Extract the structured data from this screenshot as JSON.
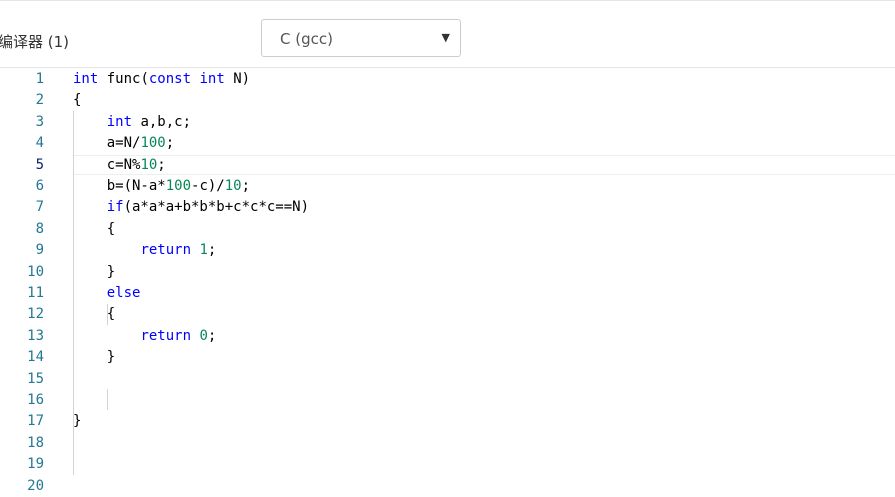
{
  "toolbar": {
    "compiler_label": "编译器 (1)",
    "language_selected": "C (gcc)",
    "dropdown_icon": "triangle-down-icon"
  },
  "editor": {
    "active_line": 5,
    "line_numbers": [
      "1",
      "2",
      "3",
      "4",
      "5",
      "6",
      "7",
      "8",
      "9",
      "10",
      "11",
      "12",
      "13",
      "14",
      "15",
      "16",
      "17",
      "18",
      "19",
      "20"
    ],
    "code_lines": [
      [
        {
          "t": "int",
          "c": "kw"
        },
        {
          "t": " func("
        },
        {
          "t": "const",
          "c": "kw"
        },
        {
          "t": " "
        },
        {
          "t": "int",
          "c": "kw"
        },
        {
          "t": " N)"
        }
      ],
      [
        {
          "t": "{"
        }
      ],
      [
        {
          "t": "    "
        },
        {
          "t": "int",
          "c": "kw"
        },
        {
          "t": " a,b,c;"
        }
      ],
      [
        {
          "t": "    a=N/"
        },
        {
          "t": "100",
          "c": "num"
        },
        {
          "t": ";"
        }
      ],
      [
        {
          "t": "    c=N%"
        },
        {
          "t": "10",
          "c": "num"
        },
        {
          "t": ";"
        }
      ],
      [
        {
          "t": "    b=(N-a*"
        },
        {
          "t": "100",
          "c": "num"
        },
        {
          "t": "-c)/"
        },
        {
          "t": "10",
          "c": "num"
        },
        {
          "t": ";"
        }
      ],
      [
        {
          "t": "    "
        },
        {
          "t": "if",
          "c": "kw"
        },
        {
          "t": "(a*a*a+b*b*b+c*c*c==N)"
        }
      ],
      [
        {
          "t": "    {"
        }
      ],
      [
        {
          "t": "        "
        },
        {
          "t": "return",
          "c": "kw"
        },
        {
          "t": " "
        },
        {
          "t": "1",
          "c": "num"
        },
        {
          "t": ";"
        }
      ],
      [
        {
          "t": "    }"
        }
      ],
      [
        {
          "t": "    "
        },
        {
          "t": "else",
          "c": "kw"
        }
      ],
      [
        {
          "t": "    {"
        }
      ],
      [
        {
          "t": "        "
        },
        {
          "t": "return",
          "c": "kw"
        },
        {
          "t": " "
        },
        {
          "t": "0",
          "c": "num"
        },
        {
          "t": ";"
        }
      ],
      [
        {
          "t": "    }"
        }
      ],
      [],
      [],
      [
        {
          "t": "}"
        }
      ],
      [],
      [],
      []
    ]
  }
}
